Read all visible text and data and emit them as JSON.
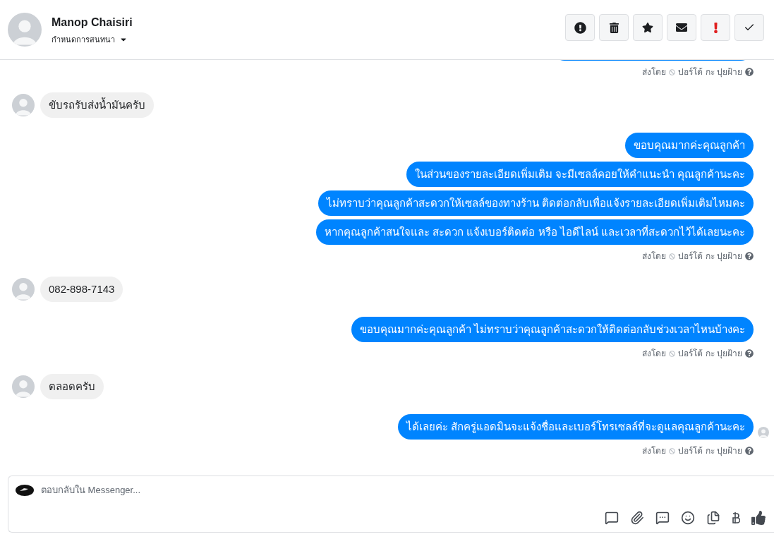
{
  "header": {
    "name": "Manop Chaisiri",
    "subtitle": "กำหนดการสนทนา"
  },
  "thread": [
    {
      "kind": "clipped"
    },
    {
      "kind": "sent_by",
      "label": "ส่งโดย",
      "name": "ปอร์โต้ กะ ปุยฝ้าย"
    },
    {
      "kind": "incoming",
      "text": "ขับรถรับส่งน้ำมันครับ"
    },
    {
      "kind": "outgoing",
      "text": "ขอบคุณมากค่ะคุณลูกค้า",
      "seen": false
    },
    {
      "kind": "outgoing",
      "text": "ในส่วนของรายละเอียดเพิ่มเติม จะมีเซลล์คอยให้คำแนะนำ คุณลูกค้านะคะ",
      "seen": false
    },
    {
      "kind": "outgoing",
      "text": "ไม่ทราบว่าคุณลูกค้าสะดวกให้เซลล์ของทางร้าน ติดต่อกลับเพื่อแจ้งรายละเอียดเพิ่มเติมไหมคะ",
      "seen": false
    },
    {
      "kind": "outgoing",
      "text": "หากคุณลูกค้าสนใจและ สะดวก แจ้งเบอร์ติดต่อ หรือ ไอดีไลน์ และเวลาที่สะดวกไว้ได้เลยนะคะ",
      "seen": false
    },
    {
      "kind": "sent_by",
      "label": "ส่งโดย",
      "name": "ปอร์โต้ กะ ปุยฝ้าย"
    },
    {
      "kind": "incoming",
      "text": "082-898-7143"
    },
    {
      "kind": "outgoing",
      "text": "ขอบคุณมากค่ะคุณลูกค้า ไม่ทราบว่าคุณลูกค้าสะดวกให้ติดต่อกลับช่วงเวลาไหนบ้างคะ",
      "seen": false
    },
    {
      "kind": "sent_by",
      "label": "ส่งโดย",
      "name": "ปอร์โต้ กะ ปุยฝ้าย"
    },
    {
      "kind": "incoming",
      "text": "ตลอดครับ"
    },
    {
      "kind": "outgoing",
      "text": "ได้เลยค่ะ สักครู่แอดมินจะแจ้งชื่อและเบอร์โทรเซลล์ที่จะดูแลคุณลูกค้านะคะ",
      "seen": true
    },
    {
      "kind": "sent_by",
      "label": "ส่งโดย",
      "name": "ปอร์โต้ กะ ปุยฝ้าย"
    }
  ],
  "composer": {
    "placeholder": "ตอบกลับใน Messenger..."
  }
}
